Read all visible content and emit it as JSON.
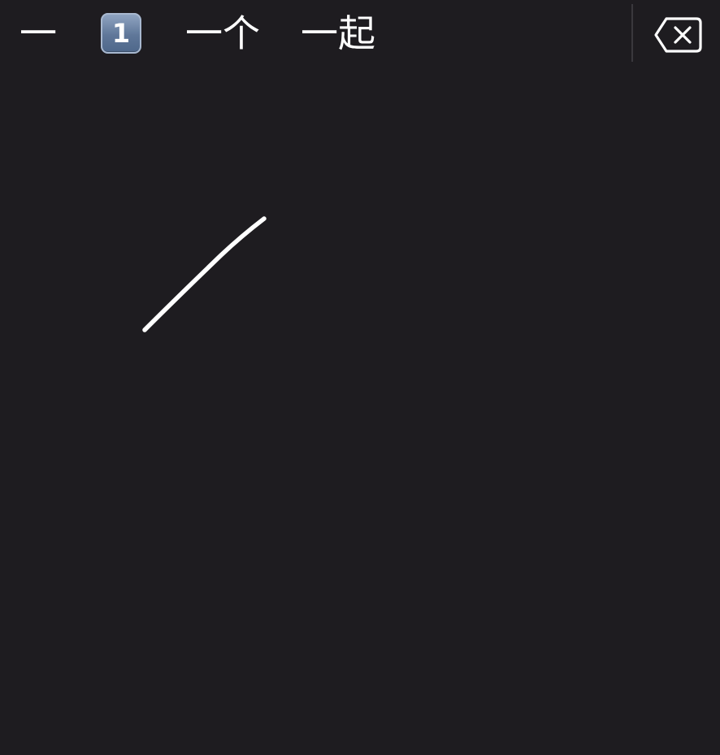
{
  "candidates": [
    {
      "label": "一"
    },
    {
      "label": "1"
    },
    {
      "label": "一个"
    },
    {
      "label": "一起"
    }
  ],
  "delete_icon": "backspace-icon",
  "colors": {
    "background": "#1e1c20",
    "text": "#ffffff",
    "divider": "#3a383d",
    "stroke": "#ffffff",
    "keycap": "#5f7799"
  }
}
